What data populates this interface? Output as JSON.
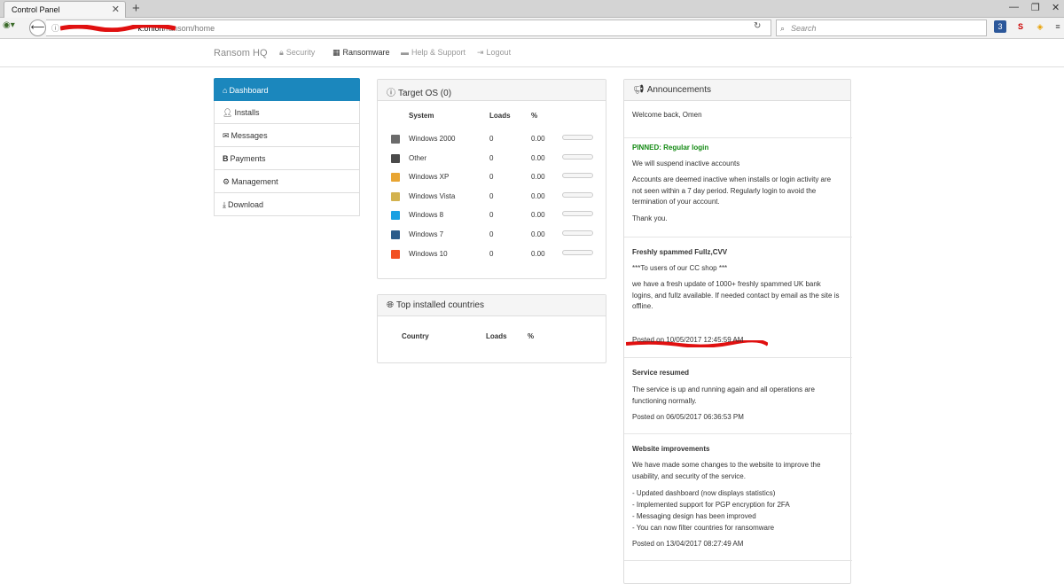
{
  "browser": {
    "tab_title": "Control Panel",
    "url_host_visible": "k.onion",
    "url_path": "/ransom/home",
    "search_placeholder": "Search",
    "ext_badge": "3"
  },
  "site": {
    "brand": "Ransom HQ",
    "nav": [
      {
        "label": "Security",
        "icon": "lock-icon"
      },
      {
        "label": "Ransomware",
        "icon": "qr-icon"
      },
      {
        "label": "Help & Support",
        "icon": "comment-icon"
      },
      {
        "label": "Logout",
        "icon": "logout-icon"
      }
    ],
    "active_nav": "Ransomware"
  },
  "sidebar": {
    "items": [
      {
        "label": "Dashboard",
        "icon": "home-icon",
        "active": true
      },
      {
        "label": "Installs",
        "icon": "user-icon"
      },
      {
        "label": "Messages",
        "icon": "envelope-icon"
      },
      {
        "label": "Payments",
        "icon": "bitcoin-icon"
      },
      {
        "label": "Management",
        "icon": "gear-icon"
      },
      {
        "label": "Download",
        "icon": "download-icon"
      }
    ]
  },
  "target_os": {
    "title": "Target OS (0)",
    "columns": [
      "System",
      "Loads",
      "%"
    ],
    "rows": [
      {
        "system": "Windows 2000",
        "loads": "0",
        "pct": "0.00",
        "icon_color": "#6b6b6b"
      },
      {
        "system": "Other",
        "loads": "0",
        "pct": "0.00",
        "icon_color": "#4a4a4a"
      },
      {
        "system": "Windows XP",
        "loads": "0",
        "pct": "0.00",
        "icon_color": "#e8a533"
      },
      {
        "system": "Windows Vista",
        "loads": "0",
        "pct": "0.00",
        "icon_color": "#d3b24f"
      },
      {
        "system": "Windows 8",
        "loads": "0",
        "pct": "0.00",
        "icon_color": "#1ba1e2"
      },
      {
        "system": "Windows 7",
        "loads": "0",
        "pct": "0.00",
        "icon_color": "#2a5b8a"
      },
      {
        "system": "Windows 10",
        "loads": "0",
        "pct": "0.00",
        "icon_color": "#f25022"
      }
    ]
  },
  "countries": {
    "title": "Top installed countries",
    "columns": [
      "Country",
      "Loads",
      "%"
    ]
  },
  "announcements": {
    "title": "Announcements",
    "welcome": "Welcome back, Omen",
    "posts": [
      {
        "title": "PINNED: Regular login",
        "pinned": true,
        "paragraphs": [
          "We will suspend inactive accounts",
          "Accounts are deemed inactive when installs or login activity are not seen within a 7 day period. Regularly login to avoid the termination of your account.",
          "Thank you."
        ]
      },
      {
        "title": "Freshly spammed Fullz,CVV",
        "paragraphs": [
          "***To users of our CC shop ***",
          "we have a fresh update of 1000+ freshly spammed UK bank logins, and fullz available. If needed contact by email as the site is offline."
        ],
        "posted": "Posted on 10/05/2017 12:45:59 AM"
      },
      {
        "title": "Service resumed",
        "paragraphs": [
          "The service is up and running again and all operations are functioning normally."
        ],
        "posted": "Posted on 06/05/2017 06:36:53 PM"
      },
      {
        "title": "Website improvements",
        "paragraphs": [
          "We have made some changes to the website to improve the usability, and security of the service.",
          "- Updated dashboard (now displays statistics)",
          "- Implemented support for PGP encryption for 2FA",
          "- Messaging design has been improved",
          "- You can now filter countries for ransomware"
        ],
        "posted": "Posted on 13/04/2017 08:27:49 AM"
      }
    ]
  },
  "colors": {
    "accent": "#1b87bd",
    "pinned": "#138a13",
    "redaction": "#e01010"
  }
}
